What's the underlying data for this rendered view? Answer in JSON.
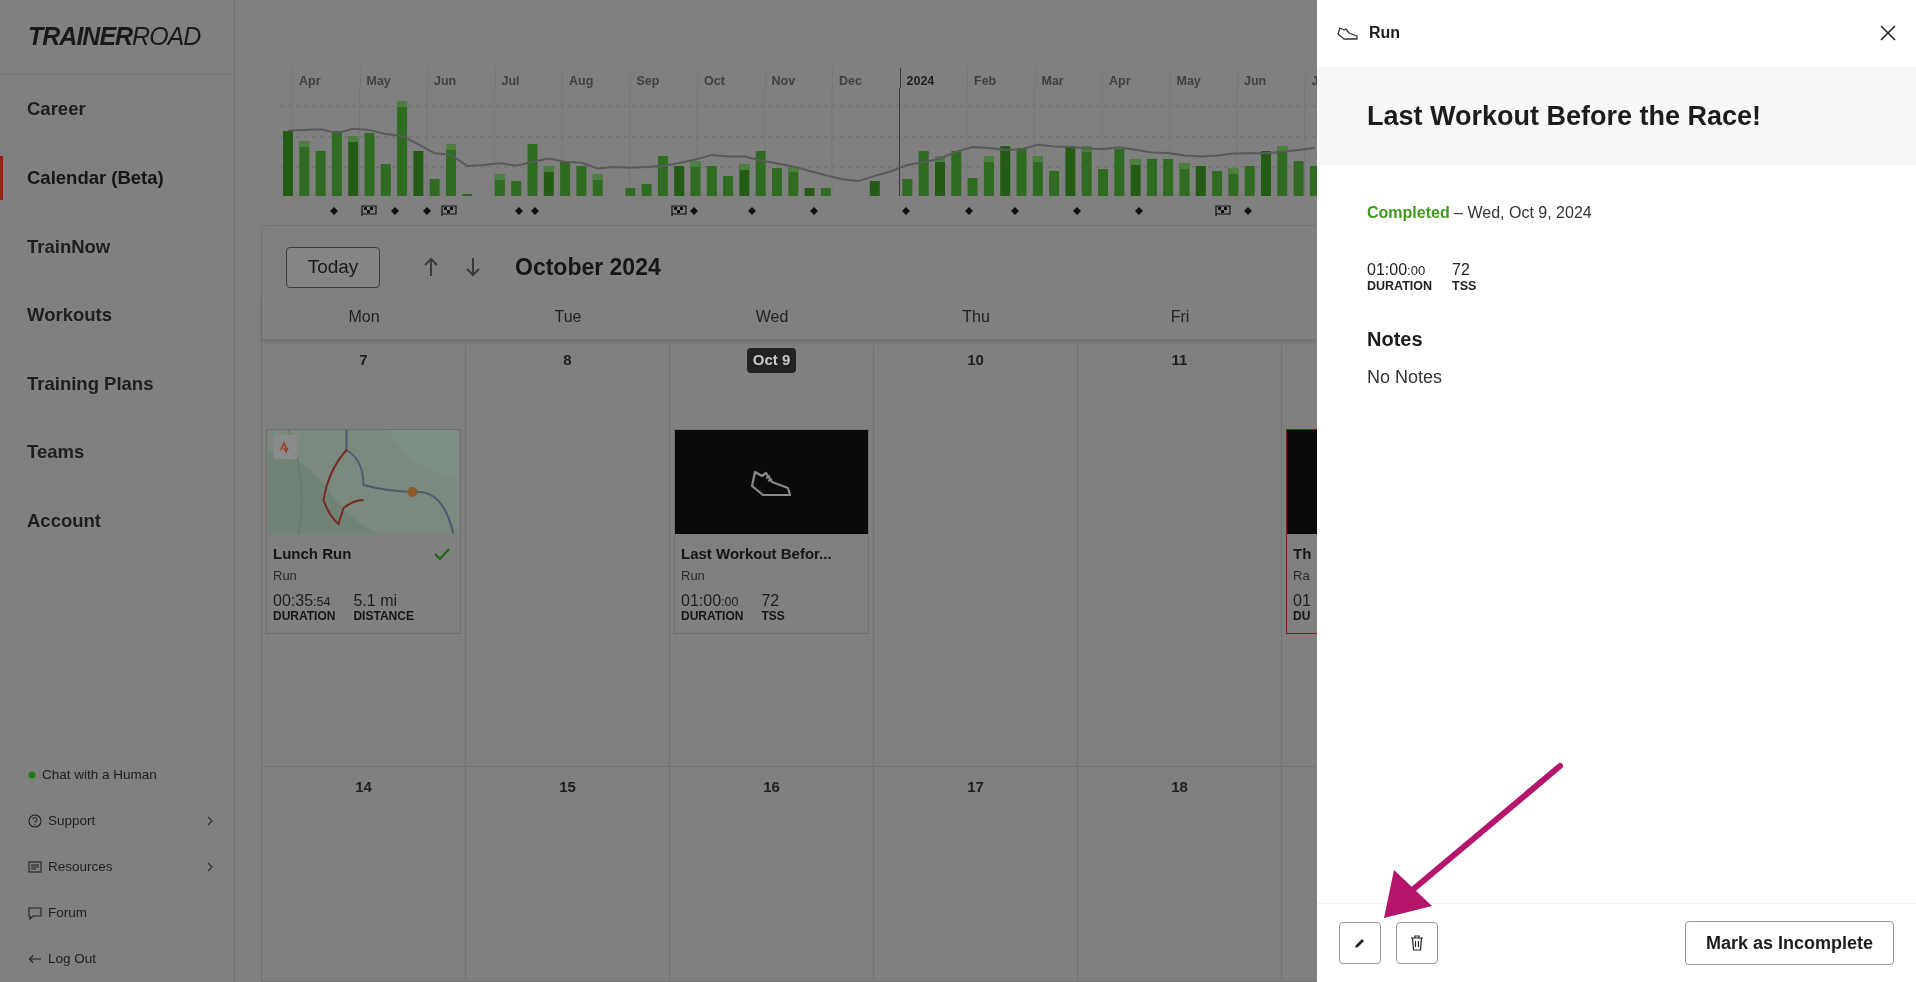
{
  "sidebar": {
    "logo": "**TRAINER**ROAD",
    "nav": [
      {
        "label": "Career",
        "selected": false
      },
      {
        "label": "Calendar (Beta)",
        "selected": true
      },
      {
        "label": "TrainNow",
        "selected": false
      },
      {
        "label": "Workouts",
        "selected": false
      },
      {
        "label": "Training Plans",
        "selected": false
      },
      {
        "label": "Teams",
        "selected": false
      },
      {
        "label": "Account",
        "selected": false
      }
    ],
    "footer_links": [
      {
        "label": "Chat with a Human",
        "kind": "status",
        "submenu": false
      },
      {
        "label": "Support",
        "kind": "help",
        "submenu": true
      },
      {
        "label": "Resources",
        "kind": "resources",
        "submenu": true
      },
      {
        "label": "Forum",
        "kind": "forum",
        "submenu": false
      },
      {
        "label": "Log Out",
        "kind": "logout",
        "submenu": false
      }
    ]
  },
  "training_chart": {
    "months": [
      {
        "label": "Apr",
        "kind": "month"
      },
      {
        "label": "May",
        "kind": "month"
      },
      {
        "label": "Jun",
        "kind": "month"
      },
      {
        "label": "Jul",
        "kind": "month"
      },
      {
        "label": "Aug",
        "kind": "month"
      },
      {
        "label": "Sep",
        "kind": "month"
      },
      {
        "label": "Oct",
        "kind": "month"
      },
      {
        "label": "Nov",
        "kind": "month"
      },
      {
        "label": "Dec",
        "kind": "month"
      },
      {
        "label": "2024",
        "kind": "year"
      },
      {
        "label": "Feb",
        "kind": "month"
      },
      {
        "label": "Mar",
        "kind": "month"
      },
      {
        "label": "Apr",
        "kind": "month"
      },
      {
        "label": "May",
        "kind": "month"
      },
      {
        "label": "Jun",
        "kind": "month"
      },
      {
        "label": "J",
        "kind": "month"
      }
    ]
  },
  "calendar": {
    "today_button": "Today",
    "month_title": "October 2024",
    "weekdays": [
      "Mon",
      "Tue",
      "Wed",
      "Thu",
      "Fri"
    ],
    "weeks": [
      {
        "days": [
          {
            "date": "7",
            "today": false,
            "workouts": [
              {
                "title": "Lunch Run",
                "sport": "Run",
                "kind": "map",
                "completed": true,
                "race": false,
                "stats": [
                  {
                    "value": "00:35:54",
                    "label": "DURATION",
                    "kind": "time"
                  },
                  {
                    "value": "5.1 mi",
                    "label": "DISTANCE",
                    "kind": "number"
                  }
                ]
              }
            ]
          },
          {
            "date": "8",
            "today": false
          },
          {
            "date": "Oct 9",
            "today": true,
            "workouts": [
              {
                "title": "Last Workout Befor...",
                "sport": "Run",
                "kind": "shoe",
                "completed": false,
                "race": false,
                "stats": [
                  {
                    "value": "01:00:00",
                    "label": "DURATION",
                    "kind": "time"
                  },
                  {
                    "value": "72",
                    "label": "TSS",
                    "kind": "number"
                  }
                ]
              }
            ]
          },
          {
            "date": "10",
            "today": false
          },
          {
            "date": "11",
            "today": false
          },
          {
            "workouts": [
              {
                "title": "Th",
                "sport": "Ra",
                "kind": "blank",
                "race": true,
                "stats": [
                  {
                    "value": "01",
                    "label": "DU",
                    "kind": "number"
                  }
                ]
              }
            ]
          }
        ]
      },
      {
        "days": [
          {
            "date": "14",
            "today": false
          },
          {
            "date": "15",
            "today": false
          },
          {
            "date": "16",
            "today": false
          },
          {
            "date": "17",
            "today": false
          },
          {
            "date": "18",
            "today": false
          }
        ]
      }
    ]
  },
  "detail_panel": {
    "sport": "Run",
    "title": "Last Workout Before the Race!",
    "status": "Completed",
    "date": "– Wed, Oct 9, 2024",
    "stats": [
      {
        "value": "01:00:00",
        "label": "DURATION",
        "kind": "time"
      },
      {
        "value": "72",
        "label": "TSS",
        "kind": "number"
      }
    ],
    "notes_heading": "Notes",
    "notes": "No Notes",
    "action_button": "Mark as Incomplete"
  }
}
